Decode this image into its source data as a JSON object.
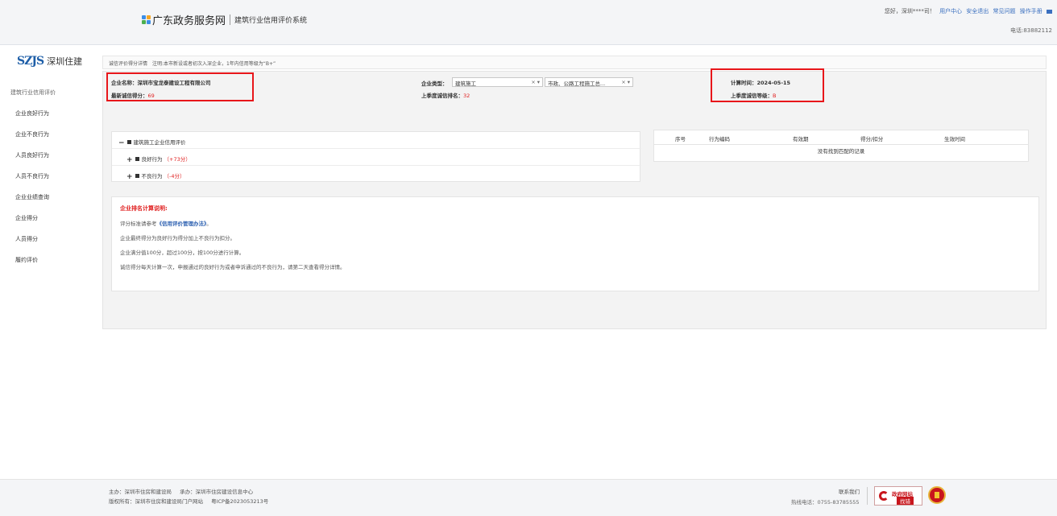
{
  "header": {
    "portal_title": "广东政务服务网",
    "system_title": "建筑行业信用评价系统",
    "greeting": "您好，深圳****司！",
    "links": [
      "用户中心",
      "安全退出",
      "常见问题",
      "操作手册"
    ],
    "phone": "电话:83882112"
  },
  "sidebar": {
    "logo_mark": "SZJS",
    "logo_text": "深圳住建",
    "section_title": "建筑行业信用评价",
    "items": [
      "企业良好行为",
      "企业不良行为",
      "人员良好行为",
      "人员不良行为",
      "企业业绩查询",
      "企业得分",
      "人员得分",
      "履约评价"
    ]
  },
  "breadcrumb": {
    "text": "诚信评价得分详情",
    "note": "注明:本市新设或者初次入深企业，1年内信用等级为“B+”"
  },
  "company": {
    "name_label": "企业名称：",
    "name": "深圳市宝龙泰建设工程有限公司",
    "score_label": "最新诚信得分：",
    "score": "69",
    "type_label": "企业类型：",
    "type_value": "建筑施工",
    "type_value2": "市政、公路工程施工总...",
    "rank_label": "上季度诚信排名：",
    "rank": "32",
    "calc_label": "计算时间：",
    "calc_date": "2024-05-15",
    "grade_label": "上季度诚信等级：",
    "grade": "B"
  },
  "tree": {
    "root": "建筑施工企业信用评价",
    "good_label": "良好行为",
    "good_score": "（+73分）",
    "bad_label": "不良行为",
    "bad_score": "（-4分）"
  },
  "table": {
    "columns": [
      "序号",
      "行为编码",
      "有效期",
      "得分/扣分",
      "生效时间"
    ],
    "empty_text": "没有找到匹配的记录"
  },
  "explanation": {
    "title": "企业排名计算说明:",
    "line1_pre": "评分标准请参考",
    "line1_link": "《信用评价管理办法》",
    "line1_post": "。",
    "line2": "企业最终得分为良好行为得分加上不良行为扣分。",
    "line3": "企业满分值100分，超过100分，按100分进行计算。",
    "line4": "诚信得分每天计算一次，申报通过的良好行为或者申诉通过的不良行为，请第二天查看得分详情。"
  },
  "footer": {
    "host": "主办：深圳市住房和建设局",
    "organizer": "承办：深圳市住房建设信息中心",
    "copyright": "版权所有：深圳市住房和建设局门户网站",
    "icp": "粤ICP备2023053213号",
    "contact": "联系我们",
    "hotline": "热线电话：0755-83785555",
    "badge_title": "政府网站",
    "badge_sub": "找错"
  },
  "colors": {
    "highlight_border": "#e8161a",
    "accent_blue": "#2b5fb0",
    "score_red": "#e02020"
  }
}
